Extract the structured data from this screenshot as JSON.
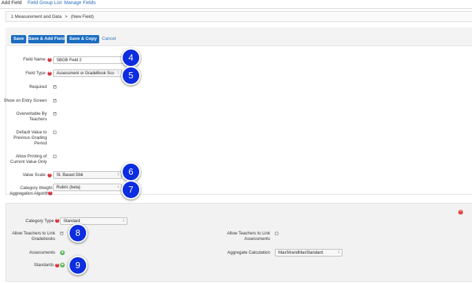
{
  "tabs": [
    "Add Field",
    "Field Group List",
    "Manage Fields"
  ],
  "breadcrumb": {
    "parent": "1 Measurement and Data",
    "sep": ">",
    "current": "(New Field)"
  },
  "toolbar": {
    "save": "Save",
    "save_add": "Save & Add Field",
    "save_copy": "Save & Copy",
    "cancel": "Cancel"
  },
  "form": {
    "field_name_label": "Field Name",
    "field_name_value": "SBGB Field 2",
    "field_type_label": "Field Type",
    "field_type_value": "Assessment or GradeBook Sco",
    "required_label": "Required",
    "show_entry_label": "Show on Entry Screen",
    "overwritable_label": "Overwritable By Teachers",
    "default_prev_label": "Default Value to Previous Grading Period",
    "allow_print_label": "Allow Printing of Current Value Only",
    "value_scale_label": "Value Scale",
    "value_scale_value": "St. Based Gbk",
    "cat_weight_label": "Category Weight Aggregation Algorithm",
    "cat_weight_value": "Rubric (beta)"
  },
  "checks": {
    "required": true,
    "show_entry": true,
    "overwritable": true,
    "default_prev": false,
    "allow_print": false
  },
  "subsection": {
    "category_type_label": "Category Type",
    "category_type_value": "Standard",
    "link_gradebooks_label": "Allow Teachers to Link Gradebooks",
    "link_assessments_label": "Allow Teachers to Link Assessments",
    "assessments_label": "Assessments",
    "aggregate_label": "Aggregate Calculation",
    "aggregate_value": "MaxStrandMaxStandard",
    "standards_label": "Standards",
    "link_gradebooks_checked": true,
    "link_assessments_checked": false
  },
  "badges": {
    "b4": "4",
    "b5": "5",
    "b6": "6",
    "b7": "7",
    "b8": "8",
    "b9": "9"
  },
  "colors": {
    "primary": "#1b6dc1",
    "required": "#d9353f",
    "callout": "#0d2de0",
    "add": "#5cb85c",
    "remove": "#e0463e"
  }
}
